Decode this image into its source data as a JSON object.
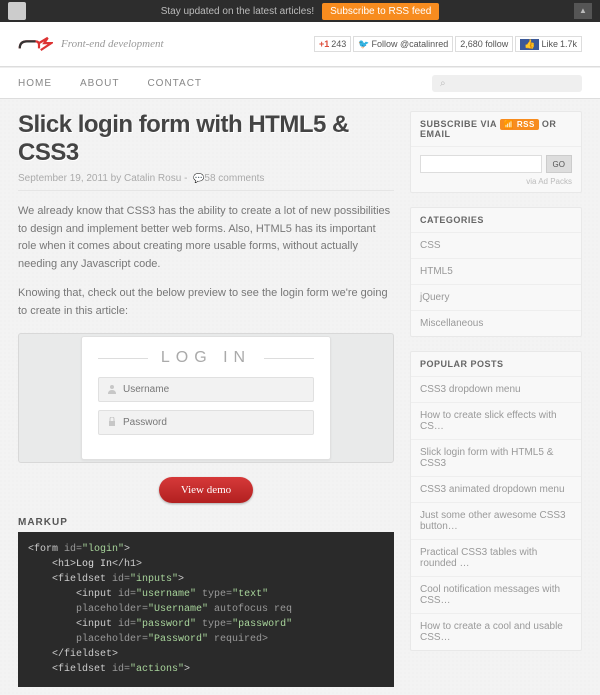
{
  "topbar": {
    "text": "Stay updated on the latest articles!",
    "button": "Subscribe to RSS feed",
    "up": "▲"
  },
  "header": {
    "tagline": "Front-end development"
  },
  "social": {
    "gplus_count": "243",
    "twitter_label": "Follow @catalinred",
    "twitter_count": "2,680 follow",
    "fb_label": "Like",
    "fb_count": "1.7k"
  },
  "nav": {
    "home": "HOME",
    "about": "ABOUT",
    "contact": "CONTACT",
    "search_icon": "⌕"
  },
  "article": {
    "title": "Slick login form with HTML5 & CSS3",
    "date": "September 19, 2011",
    "by": "by",
    "author": "Catalin Rosu",
    "sep": "-",
    "comments": "58 comments",
    "p1": "We already know that CSS3 has the ability to create a lot of new possibilities to design and implement better web forms. Also, HTML5 has its important role when it comes about creating more usable forms, without actually needing any Javascript code.",
    "p2": "Knowing that, check out the below preview to see the login form we're going to create in this article:",
    "form_title": "LOG IN",
    "ph_user": "Username",
    "ph_pass": "Password",
    "demo": "View demo",
    "markup_h": "MARKUP"
  },
  "code": {
    "l1a": "<form ",
    "l1b": "id=",
    "l1c": "\"login\"",
    "l1d": ">",
    "l2a": "<h1>",
    "l2b": "Log In",
    "l2c": "</h1>",
    "l3a": "<fieldset ",
    "l3b": "id=",
    "l3c": "\"inputs\"",
    "l3d": ">",
    "l4a": "<input ",
    "l4b": "id=",
    "l4c": "\"username\"",
    "l4d": " type=",
    "l4e": "\"text\"",
    "l4f": " placeholder=",
    "l4g": "\"Username\"",
    "l4h": " autofocus req",
    "l5a": "<input ",
    "l5b": "id=",
    "l5c": "\"password\"",
    "l5d": " type=",
    "l5e": "\"password\"",
    "l5f": " placeholder=",
    "l5g": "\"Password\"",
    "l5h": " required>",
    "l6": "</fieldset>",
    "l7a": "<fieldset ",
    "l7b": "id=",
    "l7c": "\"actions\"",
    "l7d": ">"
  },
  "subscribe": {
    "pre": "SUBSCRIBE VIA ",
    "rss": "📶 RSS",
    "post": " OR EMAIL",
    "go": "GO",
    "via": "via Ad Packs"
  },
  "categories": {
    "title": "CATEGORIES",
    "items": [
      "CSS",
      "HTML5",
      "jQuery",
      "Miscellaneous"
    ]
  },
  "popular": {
    "title": "POPULAR POSTS",
    "items": [
      "CSS3 dropdown menu",
      "How to create slick effects with CS…",
      "Slick login form with HTML5 & CSS3",
      "CSS3 animated dropdown menu",
      "Just some other awesome CSS3 button…",
      "Practical CSS3 tables with rounded …",
      "Cool notification messages with CSS…",
      "How to create a cool and usable CSS…"
    ]
  }
}
